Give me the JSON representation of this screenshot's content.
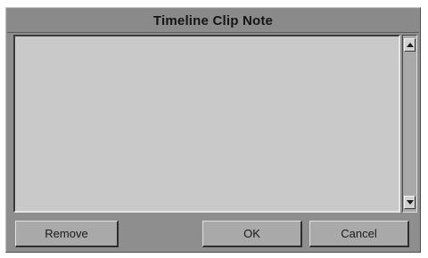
{
  "dialog": {
    "title": "Timeline Clip Note"
  },
  "note": {
    "value": "",
    "placeholder": ""
  },
  "buttons": {
    "remove": "Remove",
    "ok": "OK",
    "cancel": "Cancel"
  },
  "icons": {
    "scroll_up": "arrow-up-icon",
    "scroll_down": "arrow-down-icon"
  },
  "colors": {
    "dialog_bg": "#8e8e8e",
    "text_area_bg": "#c9c9c9",
    "button_bg": "#a9a9a9"
  }
}
